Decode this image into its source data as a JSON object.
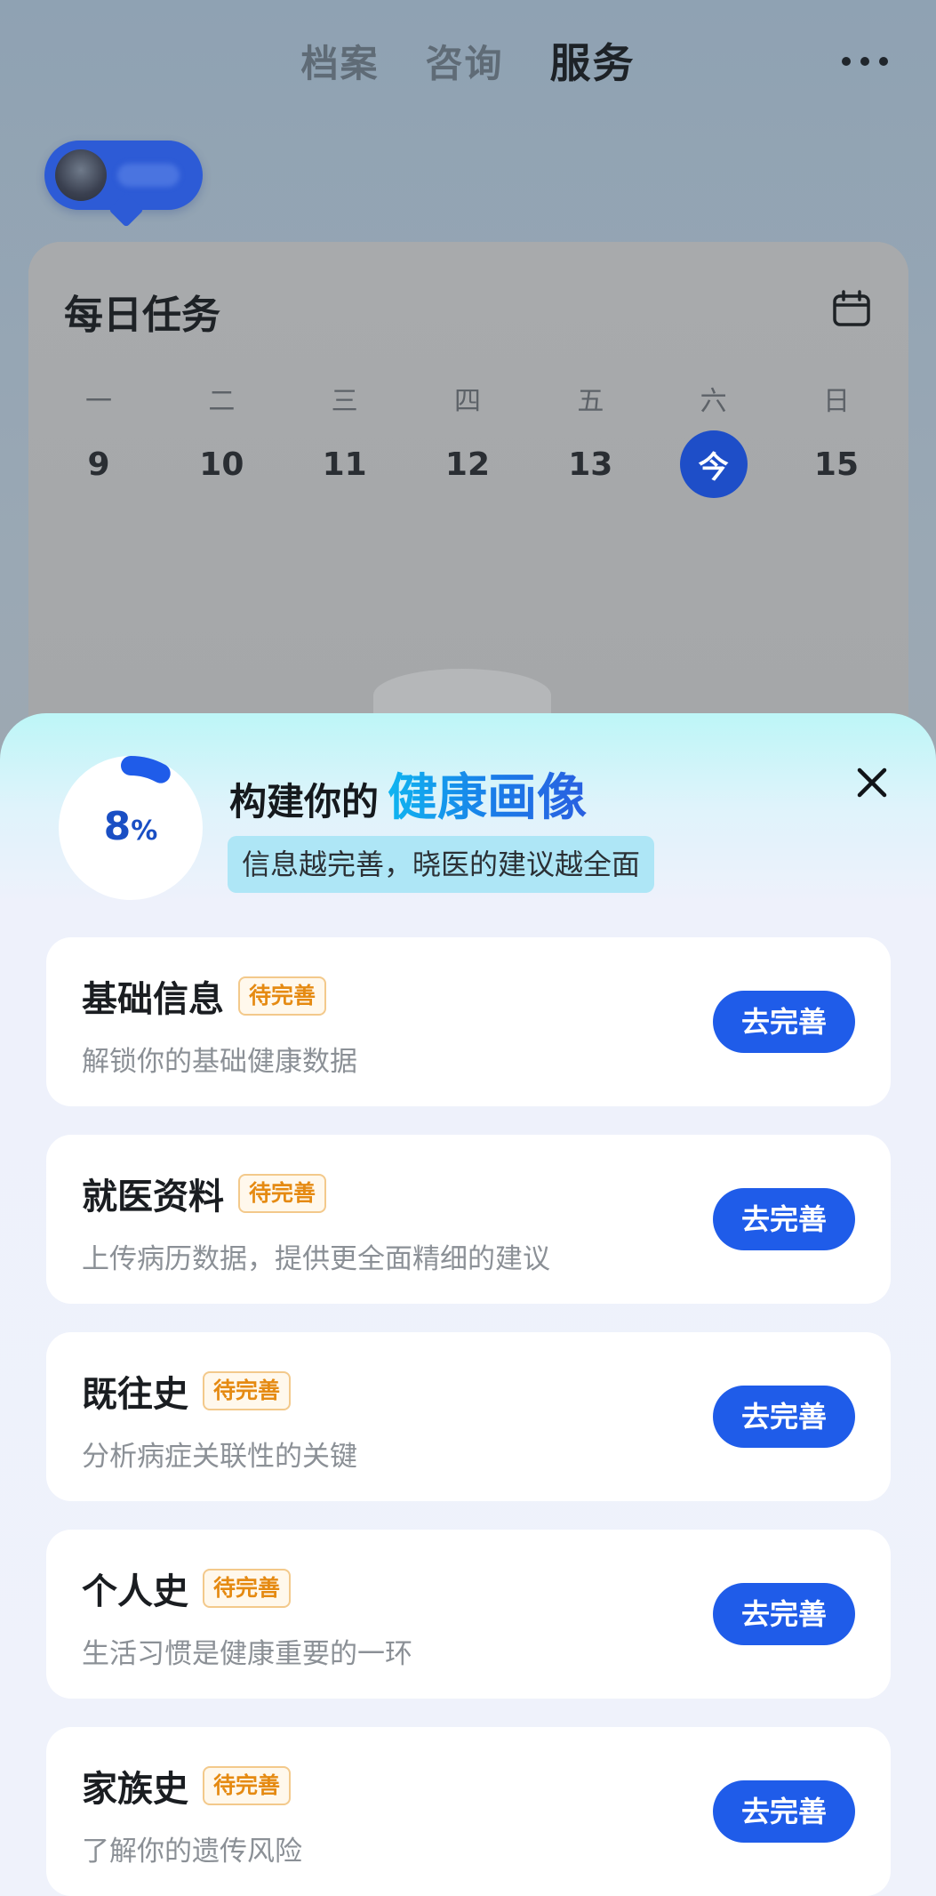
{
  "top_tabs": [
    {
      "label": "档案"
    },
    {
      "label": "咨询"
    },
    {
      "label": "服务"
    }
  ],
  "active_tab": "服务",
  "daily_task": {
    "title": "每日任务",
    "week": [
      {
        "day": "一",
        "date": "9"
      },
      {
        "day": "二",
        "date": "10"
      },
      {
        "day": "三",
        "date": "11"
      },
      {
        "day": "四",
        "date": "12"
      },
      {
        "day": "五",
        "date": "13"
      },
      {
        "day": "六",
        "date": "今"
      },
      {
        "day": "日",
        "date": "15"
      }
    ]
  },
  "sheet": {
    "progress_value": "8",
    "progress_unit": "%",
    "progress_fraction": 0.08,
    "title_prefix": "构建你的",
    "title_highlight": "健康画像",
    "subtitle": "信息越完善，晓医的建议越全面",
    "cards": [
      {
        "title": "基础信息",
        "badge": "待完善",
        "desc": "解锁你的基础健康数据",
        "button": "去完善"
      },
      {
        "title": "就医资料",
        "badge": "待完善",
        "desc": "上传病历数据，提供更全面精细的建议",
        "button": "去完善"
      },
      {
        "title": "既往史",
        "badge": "待完善",
        "desc": "分析病症关联性的关键",
        "button": "去完善"
      },
      {
        "title": "个人史",
        "badge": "待完善",
        "desc": "生活习惯是健康重要的一环",
        "button": "去完善"
      },
      {
        "title": "家族史",
        "badge": "待完善",
        "desc": "了解你的遗传风险",
        "button": "去完善"
      }
    ]
  },
  "colors": {
    "primary": "#1f5ce9",
    "badge_text": "#e58a12",
    "highlight_start": "#0fb5f0",
    "highlight_end": "#2a5fe0"
  },
  "icons": [
    "more-icon",
    "avatar",
    "calendar-icon",
    "close-icon",
    "progress-ring"
  ]
}
